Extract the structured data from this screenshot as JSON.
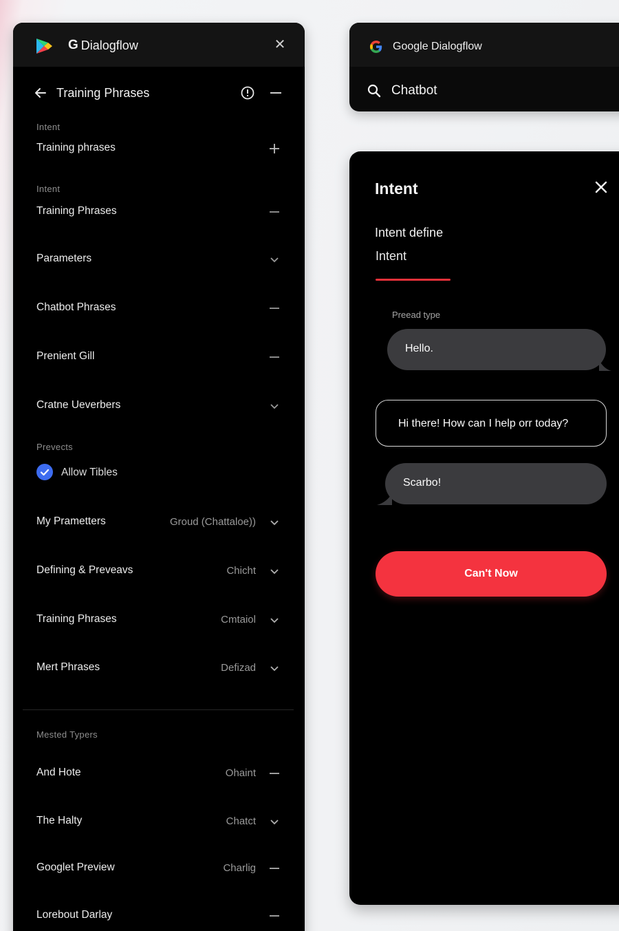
{
  "left_panel": {
    "brand": "Dialogflow",
    "brand_mark": "G",
    "header_title": "Training Phrases",
    "sections": [
      {
        "label": "Intent"
      },
      {
        "label": "Intent"
      },
      {
        "label": "Prevects"
      },
      {
        "label": "Mested Typers"
      }
    ],
    "rows": [
      {
        "label": "Training phrases",
        "value": "",
        "control": "plus"
      },
      {
        "label": "Training Phrases",
        "value": "",
        "control": "minus"
      },
      {
        "label": "Parameters",
        "value": "",
        "control": "chevron"
      },
      {
        "label": "Chatbot Phrases",
        "value": "",
        "control": "minus"
      },
      {
        "label": "Prenient Gill",
        "value": "",
        "control": "minus"
      },
      {
        "label": "Cratne Ueverbers",
        "value": "",
        "control": "chevron"
      },
      {
        "label": "Allow Tibles",
        "value": "",
        "control": "check",
        "checked": true
      },
      {
        "label": "My Prametters",
        "value": "Groud (Chattaloe))",
        "control": "chevron"
      },
      {
        "label": "Defining & Preveavs",
        "value": "Chicht",
        "control": "chevron"
      },
      {
        "label": "Training Phrases",
        "value": "Cmtaiol",
        "control": "chevron"
      },
      {
        "label": "Mert Phrases",
        "value": "Defizad",
        "control": "chevron"
      },
      {
        "label": "And Hote",
        "value": "Ohaint",
        "control": "minus"
      },
      {
        "label": "The Halty",
        "value": "Chatct",
        "control": "chevron"
      },
      {
        "label": "Googlet Preview",
        "value": "Charlig",
        "control": "minus"
      },
      {
        "label": "Lorebout Darlay",
        "value": "",
        "control": "minus"
      }
    ]
  },
  "top_card": {
    "brand": "Google Dialogflow",
    "search_text": "Chatbot"
  },
  "intent_card": {
    "title": "Intent",
    "subtitle": "Intent define",
    "tab": "Intent",
    "caption": "Preead type",
    "messages": [
      {
        "role": "user",
        "text": "Hello."
      },
      {
        "role": "bot",
        "text": "Hi there! How can I help orr today?"
      },
      {
        "role": "user",
        "text": "Scarbo!"
      }
    ],
    "cta_label": "Can't Now"
  },
  "colors": {
    "accent_red": "#f4333f",
    "check_blue": "#3d6cf0",
    "bubble_gray": "#3b3b3e"
  }
}
